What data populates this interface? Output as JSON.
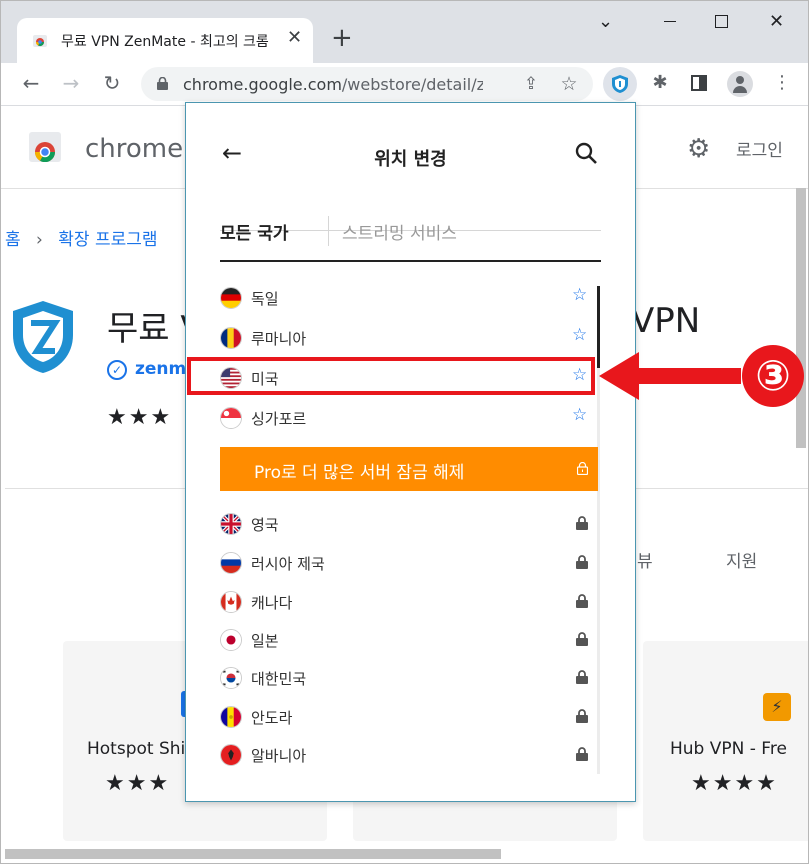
{
  "browser": {
    "tab_title": "무료 VPN ZenMate - 최고의 크롬",
    "tab_close": "✕",
    "new_tab": "+",
    "url_host": "chrome.google.com",
    "url_path": "/webstore/detail/z...",
    "window_controls": {
      "minimize": "⌄",
      "restore": "☐",
      "close": "✕"
    }
  },
  "store": {
    "logo_text": "chrome",
    "login": "로그인",
    "breadcrumb_home": "홈",
    "breadcrumb_sep": "›",
    "breadcrumb_item": "확장 프로그램",
    "title_start": "무료 V",
    "title_end": "VPN",
    "publisher": "zenmat",
    "stars": "★★★",
    "tab_reviews_partial": "뷰",
    "tab_support": "지원",
    "cards": [
      {
        "title": "Hotspot Shi",
        "stars": "★★★"
      },
      {
        "title": "Hub VPN - Fre",
        "stars": "★★★★"
      }
    ]
  },
  "popup": {
    "title": "위치 변경",
    "tab_all": "모든 국가",
    "tab_streaming": "스트리밍 서비스",
    "free_countries": [
      {
        "name": "독일",
        "flag": "germany"
      },
      {
        "name": "루마니아",
        "flag": "romania"
      },
      {
        "name": "미국",
        "flag": "usa"
      },
      {
        "name": "싱가포르",
        "flag": "singapore"
      }
    ],
    "promo_text": "Pro로 더 많은 서버 잠금 해제",
    "locked_countries": [
      {
        "name": "영국",
        "flag": "uk"
      },
      {
        "name": "러시아 제국",
        "flag": "russia"
      },
      {
        "name": "캐나다",
        "flag": "canada"
      },
      {
        "name": "일본",
        "flag": "japan"
      },
      {
        "name": "대한민국",
        "flag": "korea"
      },
      {
        "name": "안도라",
        "flag": "andorra"
      },
      {
        "name": "알바니아",
        "flag": "albania"
      }
    ]
  },
  "annotation": {
    "step_number": "③",
    "color": "#e8171c"
  }
}
